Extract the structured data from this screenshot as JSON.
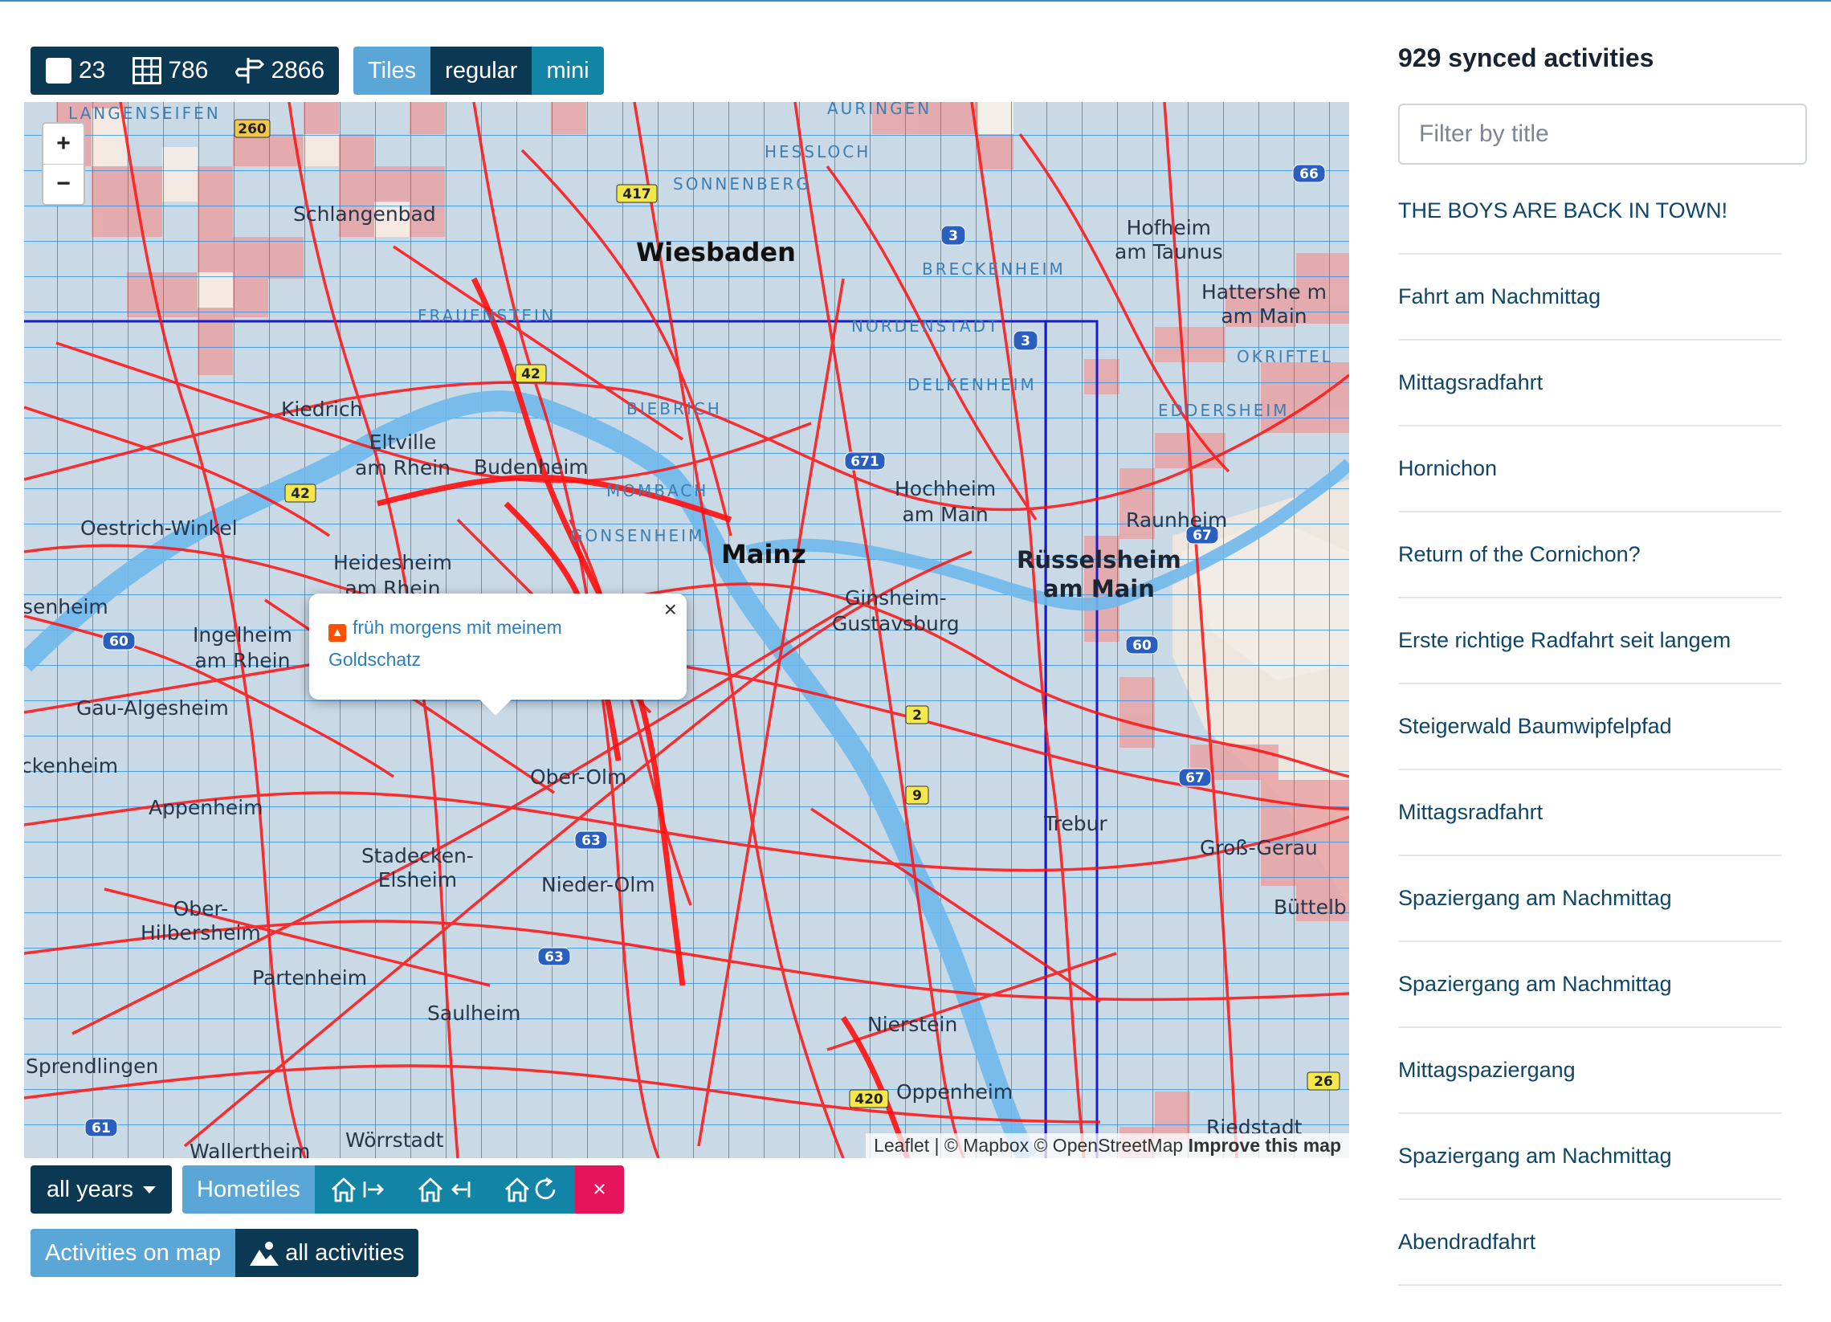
{
  "stats": {
    "squares": "23",
    "tiles": "786",
    "explorer": "2866"
  },
  "tiles_toggle": {
    "label": "Tiles",
    "regular": "regular",
    "mini": "mini"
  },
  "map": {
    "zoom_in": "+",
    "zoom_out": "−",
    "attribution_leaflet": "Leaflet",
    "attribution_sep": " | © Mapbox © OpenStreetMap ",
    "attribution_improve": "Improve this map",
    "labels": {
      "langenseifen": "LANGENSEIFEN",
      "hessloch": "HESSLOCH",
      "sonnenberg": "SONNENBERG",
      "auringen": "AURINGEN",
      "schlangenbad": "Schlangenbad",
      "wiesbaden": "Wiesbaden",
      "hofheim": "Hofheim\nam Taunus",
      "breckenheim": "BRECKENHEIM",
      "hattersheim": "Hattershe m\nam Main",
      "frauenstein": "FRAUENSTEIN",
      "nordenstadt": "NORDENSTADT",
      "okriftel": "OKRIFTEL",
      "delkenheim": "DELKENHEIM",
      "eddersheim": "EDDERSHEIM",
      "kiedrich": "Kiedrich",
      "eltville": "Eltville\nam Rhein",
      "budenheim": "Budenheim",
      "biebrich": "BIEBRICH",
      "mombach": "MOMBACH",
      "hochheim": "Hochheim\nam Main",
      "raunheim": "Raunheim",
      "oestrich": "Oestrich-Winkel",
      "heidesheim": "Heidesheim\nam Rhein",
      "mainz": "Mainz",
      "russelsheim": "Rüsselsheim\nam Main",
      "gonsenheim": "GONSENHEIM",
      "senheim": "senheim",
      "ingelheim": "Ingelheim\nam Rhein",
      "ginsheim": "Ginsheim-\nGustavsburg",
      "gau": "Gau-Algesheim",
      "ckenheim": "ckenheim",
      "oberolm": "Ober-Olm",
      "appenheim": "Appenheim",
      "trebur": "Trebur",
      "gross_gerau": "Groß-Gerau",
      "stadecken": "Stadecken-\nElsheim",
      "niederolm": "Nieder-Olm",
      "ober_hilbersheim": "Ober-\nHilbersheim",
      "buttelborn": "Büttelb",
      "partenheim": "Partenheim",
      "saulheim": "Saulheim",
      "nierstein": "Nierstein",
      "sprendlingen": "Sprendlingen",
      "oppenheim": "Oppenheim",
      "riedstadt": "Riedstadt",
      "wallertheim": "Wallertheim",
      "worrstadt": "Wörrstadt"
    },
    "shields": {
      "s260": "260",
      "s417": "417",
      "s42a": "42",
      "s42b": "42",
      "s60a": "60",
      "s60b": "60",
      "s67a": "67",
      "s67b": "67",
      "s3a": "3",
      "s3b": "3",
      "s66": "66",
      "s671": "671",
      "s63": "63",
      "s63b": "63",
      "s61": "61",
      "s26": "26",
      "s420": "420",
      "s9": "9",
      "s2": "2"
    },
    "popup": {
      "title": "früh morgens mit meinem Goldschatz",
      "close": "×"
    }
  },
  "controls": {
    "years": "all years",
    "hometiles": "Hometiles",
    "clear": "×",
    "activities_on_map": "Activities on map",
    "all_activities": "all activities"
  },
  "sidebar": {
    "title": "929 synced activities",
    "filter_placeholder": "Filter by title",
    "items": [
      "THE BOYS ARE BACK IN TOWN!",
      "Fahrt am Nachmittag",
      "Mittagsradfahrt",
      "Hornichon",
      "Return of the Cornichon?",
      "Erste richtige Radfahrt seit langem",
      "Steigerwald Baumwipfelpfad",
      "Mittagsradfahrt",
      "Spaziergang am Nachmittag",
      "Spaziergang am Nachmittag",
      "Mittagspaziergang",
      "Spaziergang am Nachmittag",
      "Abendradfahrt"
    ]
  },
  "colors": {
    "dark": "#0b3852",
    "light": "#5aa6d6",
    "teal": "#1284a6",
    "danger": "#e6155b",
    "track": "#ff1010",
    "grid": "#1e8fe6",
    "square": "#1a1ad0"
  }
}
